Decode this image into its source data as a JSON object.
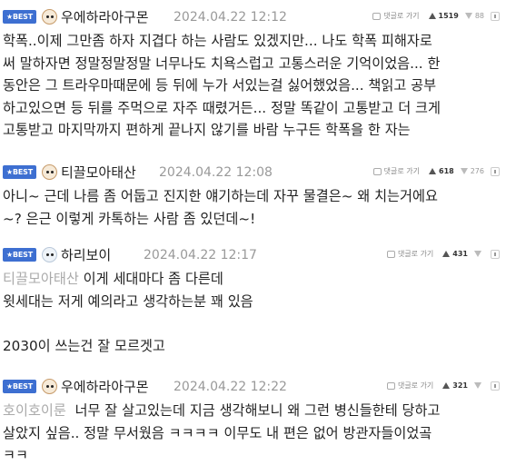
{
  "comments": [
    {
      "badge": "★BEST",
      "nickname": "우에하라아구몬",
      "date": "2024.04.22 12:12",
      "reply_label": "댓글로 가기",
      "up": "1519",
      "down": "88",
      "mention": "",
      "text": "학폭..이제 그만좀 하자 지겹다 하는 사람도 있겠지만... 나도 학폭 피해자로\n써 말하자면 정말정말정말 너무나도 치욕스럽고 고통스러운 기억이었음... 한\n동안은 그 트라우마때문에 등 뒤에 누가 서있는걸 싫어했었음... 책읽고 공부\n하고있으면 등 뒤를 주먹으로 자주 때렸거든... 정말 똑같이 고통받고 더 크게\n고통받고 마지막까지 편하게 끝나지 않기를 바람 누구든 학폭을 한 자는"
    },
    {
      "badge": "★BEST",
      "nickname": "티끌모아태산",
      "date": "2024.04.22 12:08",
      "reply_label": "댓글로 가기",
      "up": "618",
      "down": "276",
      "mention": "",
      "text": "아니~ 근데 나름 좀 어둡고 진지한 얘기하는데 자꾸 물결은~ 왜 치는거에요\n~? 은근 이렇게 카톡하는 사람 좀 있던데~!"
    },
    {
      "badge": "★BEST",
      "nickname": "하리보이",
      "date": "2024.04.22 12:17",
      "reply_label": "댓글로 가기",
      "up": "431",
      "down": "",
      "mention": "티끌모아태산",
      "text": " 이게 세대마다 좀 다른데\n윗세대는 저게 예의라고 생각하는분 꽤 있음\n\n2030이 쓰는건 잘 모르겟고"
    },
    {
      "badge": "★BEST",
      "nickname": "우에하라아구몬",
      "date": "2024.04.22 12:22",
      "reply_label": "댓글로 가기",
      "up": "321",
      "down": "",
      "mention": "호이호이룬",
      "text": "  너무 잘 살고있는데 지금 생각해보니 왜 그런 병신들한테 당하고\n살았지 싶음.. 정말 무서웠음 ㅋㅋㅋㅋ 이무도 내 편은 없어 방관자들이었곸\nㅋㅋ"
    }
  ]
}
